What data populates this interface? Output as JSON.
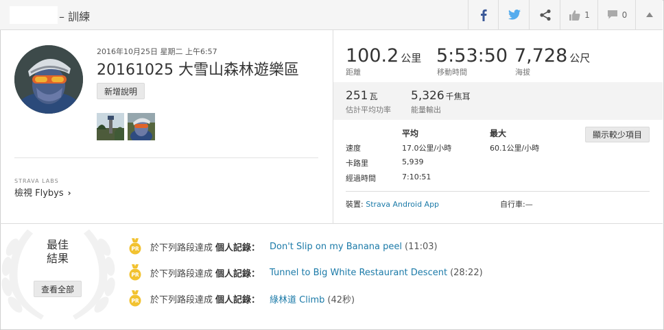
{
  "header": {
    "title": "– 訓練",
    "like_count": "1",
    "comment_count": "0"
  },
  "activity": {
    "date": "2016年10月25日 星期二 上午6:57",
    "title": "20161025 大雪山森林遊樂區",
    "add_description": "新增說明"
  },
  "labs": {
    "label": "STRAVA LABS",
    "flyby_label": "檢視 Flybys",
    "chevron": "›"
  },
  "stats": {
    "distance": {
      "value": "100.2",
      "unit": "公里",
      "label": "距離"
    },
    "moving_time": {
      "value": "5:53:50",
      "label": "移動時間"
    },
    "elevation": {
      "value": "7,728",
      "unit": "公尺",
      "label": "海拔"
    },
    "power": {
      "value": "251",
      "unit": "瓦",
      "label": "估計平均功率"
    },
    "energy": {
      "value": "5,326",
      "unit": "千焦耳",
      "label": "能量輸出"
    }
  },
  "details": {
    "col_avg": "平均",
    "col_max": "最大",
    "show_less": "顯示較少項目",
    "rows": [
      {
        "label": "速度",
        "avg": "17.0公里/小時",
        "max": "60.1公里/小時"
      },
      {
        "label": "卡路里",
        "avg": "5,939"
      },
      {
        "label": "經過時間",
        "avg": "7:10:51"
      }
    ],
    "device_label": "裝置:",
    "device_value": "Strava Android App",
    "bike_label": "自行車:",
    "bike_value": "—"
  },
  "achievements": {
    "best_title_1": "最佳",
    "best_title_2": "結果",
    "view_all": "查看全部",
    "prefix": "於下列路段達成",
    "pr_label": "個人記錄：",
    "medal_text": "PR",
    "items": [
      {
        "segment": "Don't Slip on my Banana peel",
        "time": "(11:03)"
      },
      {
        "segment": "Tunnel to Big White Restaurant Descent",
        "time": "(28:22)"
      },
      {
        "segment": "綠林道 Climb",
        "time": "(42秒)"
      }
    ]
  },
  "colors": {
    "link": "#1b7aa8",
    "medal": "#f2c230",
    "facebook": "#3b5998",
    "twitter": "#55acee"
  }
}
